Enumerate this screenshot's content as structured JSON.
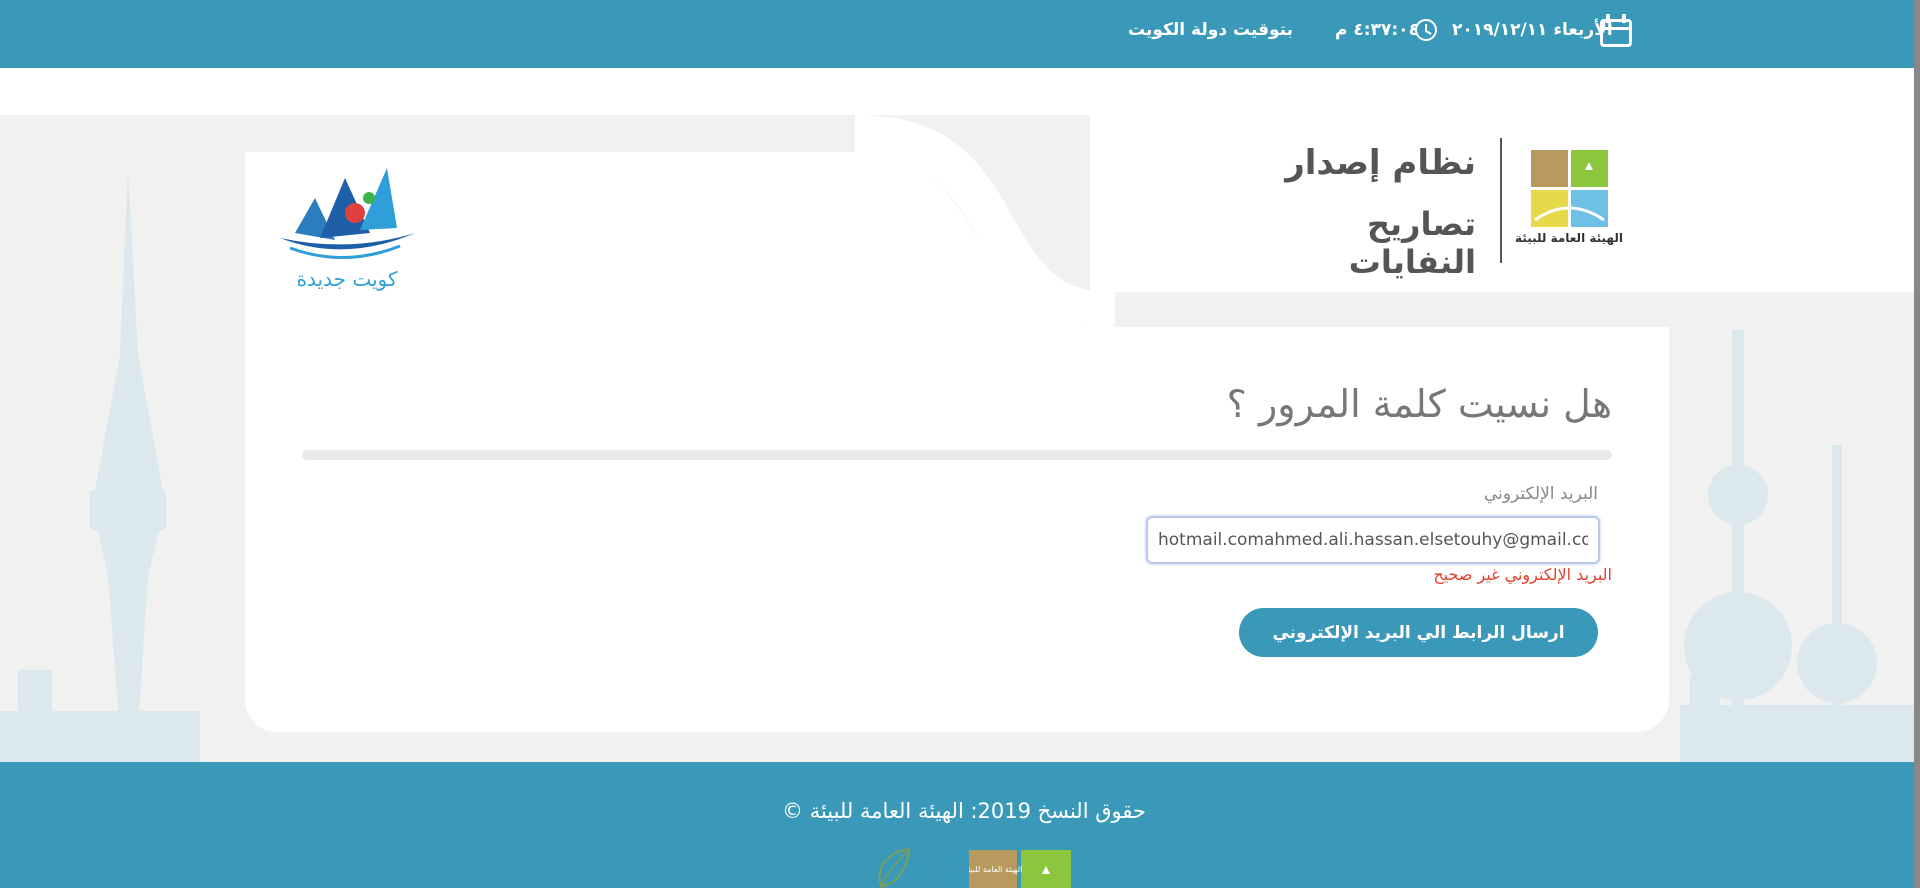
{
  "topbar": {
    "date": "الأربعاء ٢٠١٩/١٢/١١",
    "time": "٤:٣٧:٠٤ م",
    "timezone": "بتوقيت دولة الكويت",
    "icons": [
      "calendar-icon",
      "clock-icon"
    ]
  },
  "header": {
    "logo_caption": "الهيئة العامة للبيئة",
    "logo_text": "الهيئة العامة للبيئة",
    "system_title_line1": "نظام إصدار",
    "system_title_line2": "تصاريح النفايات",
    "kuwait_logo_text": "كويت جديدة"
  },
  "form": {
    "title": "هل نسيت كلمة المرور ؟",
    "email_label": "البريد الإلكتروني",
    "email_value": "hotmail.comahmed.ali.hassan.elsetouhy@gmail.com",
    "email_error": "البريد الإلكتروني غير صحيح",
    "submit_label": "ارسال الرابط الي البريد الإلكتروني"
  },
  "footer": {
    "copyright": "حقوق النسخ 2019: الهيئة العامة للبيئة  ©",
    "mini_logo_text": "الهيئة العامة للبيئة"
  },
  "colors": {
    "primary": "#3a98b9",
    "error": "#e0432d",
    "background": "#f1f1f1",
    "skyline": "#dbe8ee"
  }
}
